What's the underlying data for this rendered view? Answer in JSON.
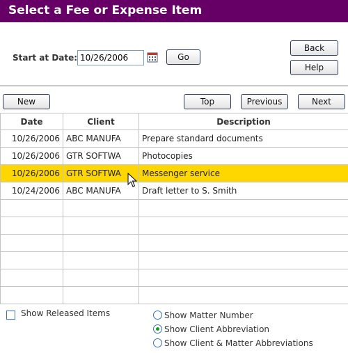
{
  "window": {
    "title": "Select a Fee or Expense Item"
  },
  "filter": {
    "start_label": "Start at Date:",
    "start_value": "10/26/2006",
    "go_label": "Go"
  },
  "side_buttons": {
    "back_label": "Back",
    "help_label": "Help"
  },
  "toolbar": {
    "new_label": "New",
    "top_label": "Top",
    "previous_label": "Previous",
    "next_label": "Next"
  },
  "grid": {
    "columns": [
      "Date",
      "Client",
      "Description"
    ],
    "rows": [
      [
        "10/26/2006",
        "ABC MANUFA",
        "Prepare standard documents"
      ],
      [
        "10/26/2006",
        "GTR SOFTWA",
        "Photocopies"
      ],
      [
        "10/26/2006",
        "GTR SOFTWA",
        "Messenger service"
      ],
      [
        "10/24/2006",
        "ABC MANUFA",
        "Draft letter to S. Smith"
      ]
    ],
    "selected_row": 2,
    "empty_rows": 6
  },
  "options": {
    "show_released_label": "Show Released Items",
    "show_released_checked": false,
    "radios": [
      {
        "label": "Show Matter Number",
        "checked": false
      },
      {
        "label": "Show Client Abbreviation",
        "checked": true
      },
      {
        "label": "Show Client & Matter Abbreviations",
        "checked": false
      }
    ]
  },
  "colors": {
    "title_bar": "#660066",
    "selected_row": "#ffd700",
    "radio_selected": "#1a9a2a"
  }
}
